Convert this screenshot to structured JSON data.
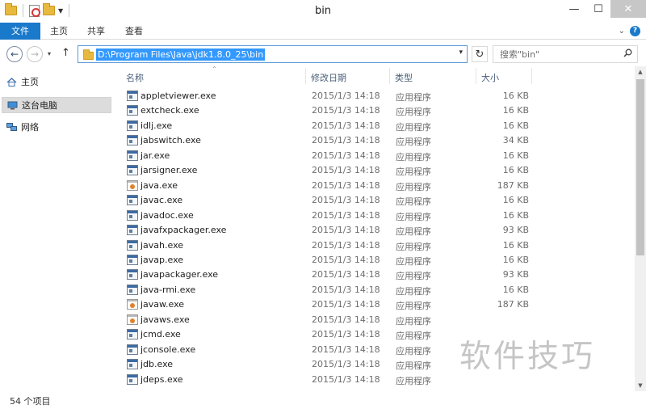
{
  "window": {
    "title": "bin",
    "minimize": "—",
    "maximize": "☐",
    "close": "✕"
  },
  "ribbon": {
    "tabs": [
      "文件",
      "主页",
      "共享",
      "查看"
    ],
    "expand_glyph": "⌄",
    "help_glyph": "?"
  },
  "address": {
    "path": "D:\\Program Files\\Java\\jdk1.8.0_25\\bin",
    "dropdown_glyph": "▾",
    "refresh_glyph": "↻"
  },
  "search": {
    "placeholder": "搜索\"bin\""
  },
  "nav": {
    "back_glyph": "←",
    "forward_glyph": "→",
    "history_glyph": "▾",
    "up_glyph": "↑",
    "items": [
      {
        "label": "主页",
        "icon": "home-icon"
      },
      {
        "label": "这台电脑",
        "icon": "computer-icon"
      },
      {
        "label": "网络",
        "icon": "network-icon"
      }
    ]
  },
  "columns": {
    "name": "名称",
    "date": "修改日期",
    "type": "类型",
    "size": "大小"
  },
  "files": [
    {
      "name": "appletviewer.exe",
      "date": "2015/1/3 14:18",
      "type": "应用程序",
      "size": "16 KB",
      "icon": "exe"
    },
    {
      "name": "extcheck.exe",
      "date": "2015/1/3 14:18",
      "type": "应用程序",
      "size": "16 KB",
      "icon": "exe"
    },
    {
      "name": "idlj.exe",
      "date": "2015/1/3 14:18",
      "type": "应用程序",
      "size": "16 KB",
      "icon": "exe"
    },
    {
      "name": "jabswitch.exe",
      "date": "2015/1/3 14:18",
      "type": "应用程序",
      "size": "34 KB",
      "icon": "exe"
    },
    {
      "name": "jar.exe",
      "date": "2015/1/3 14:18",
      "type": "应用程序",
      "size": "16 KB",
      "icon": "exe"
    },
    {
      "name": "jarsigner.exe",
      "date": "2015/1/3 14:18",
      "type": "应用程序",
      "size": "16 KB",
      "icon": "exe"
    },
    {
      "name": "java.exe",
      "date": "2015/1/3 14:18",
      "type": "应用程序",
      "size": "187 KB",
      "icon": "java"
    },
    {
      "name": "javac.exe",
      "date": "2015/1/3 14:18",
      "type": "应用程序",
      "size": "16 KB",
      "icon": "exe"
    },
    {
      "name": "javadoc.exe",
      "date": "2015/1/3 14:18",
      "type": "应用程序",
      "size": "16 KB",
      "icon": "exe"
    },
    {
      "name": "javafxpackager.exe",
      "date": "2015/1/3 14:18",
      "type": "应用程序",
      "size": "93 KB",
      "icon": "exe"
    },
    {
      "name": "javah.exe",
      "date": "2015/1/3 14:18",
      "type": "应用程序",
      "size": "16 KB",
      "icon": "exe"
    },
    {
      "name": "javap.exe",
      "date": "2015/1/3 14:18",
      "type": "应用程序",
      "size": "16 KB",
      "icon": "exe"
    },
    {
      "name": "javapackager.exe",
      "date": "2015/1/3 14:18",
      "type": "应用程序",
      "size": "93 KB",
      "icon": "exe"
    },
    {
      "name": "java-rmi.exe",
      "date": "2015/1/3 14:18",
      "type": "应用程序",
      "size": "16 KB",
      "icon": "exe"
    },
    {
      "name": "javaw.exe",
      "date": "2015/1/3 14:18",
      "type": "应用程序",
      "size": "187 KB",
      "icon": "java"
    },
    {
      "name": "javaws.exe",
      "date": "2015/1/3 14:18",
      "type": "应用程序",
      "size": "",
      "icon": "java"
    },
    {
      "name": "jcmd.exe",
      "date": "2015/1/3 14:18",
      "type": "应用程序",
      "size": "",
      "icon": "exe"
    },
    {
      "name": "jconsole.exe",
      "date": "2015/1/3 14:18",
      "type": "应用程序",
      "size": "",
      "icon": "exe"
    },
    {
      "name": "jdb.exe",
      "date": "2015/1/3 14:18",
      "type": "应用程序",
      "size": "",
      "icon": "exe"
    },
    {
      "name": "jdeps.exe",
      "date": "2015/1/3 14:18",
      "type": "应用程序",
      "size": "",
      "icon": "exe"
    }
  ],
  "status": {
    "item_count": "54 个项目"
  },
  "watermark": "软件技巧",
  "colors": {
    "file_tab": "#1979ca",
    "address_selection": "#3399ff"
  }
}
